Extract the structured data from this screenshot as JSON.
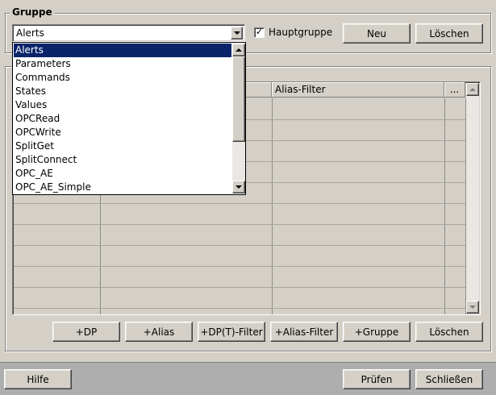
{
  "gruppe": {
    "legend": "Gruppe",
    "combo_value": "Alerts",
    "hauptgruppe_label": "Hauptgruppe",
    "hauptgruppe_checked": true,
    "check_glyph": "✓",
    "neu_label": "Neu",
    "loeschen_label": "Löschen"
  },
  "dropdown": {
    "selected_index": 0,
    "options": [
      "Alerts",
      "Parameters",
      "Commands",
      "States",
      "Values",
      "OPCRead",
      "OPCWrite",
      "SplitGet",
      "SplitConnect",
      "OPC_AE",
      "OPC_AE_Simple"
    ]
  },
  "table": {
    "columns": [
      "",
      "",
      "Alias-Filter",
      "..."
    ]
  },
  "actions": {
    "dp_label": "+DP",
    "alias_label": "+Alias",
    "dpt_filter_label": "+DP(T)-Filter",
    "alias_filter_label": "+Alias-Filter",
    "gruppe_label": "+Gruppe",
    "loeschen_label": "Löschen"
  },
  "footer": {
    "hilfe_label": "Hilfe",
    "pruefen_label": "Prüfen",
    "schliessen_label": "Schließen"
  },
  "colors": {
    "selection": "#0a246a",
    "face": "#d4d0c8",
    "footer": "#aeaeae"
  }
}
